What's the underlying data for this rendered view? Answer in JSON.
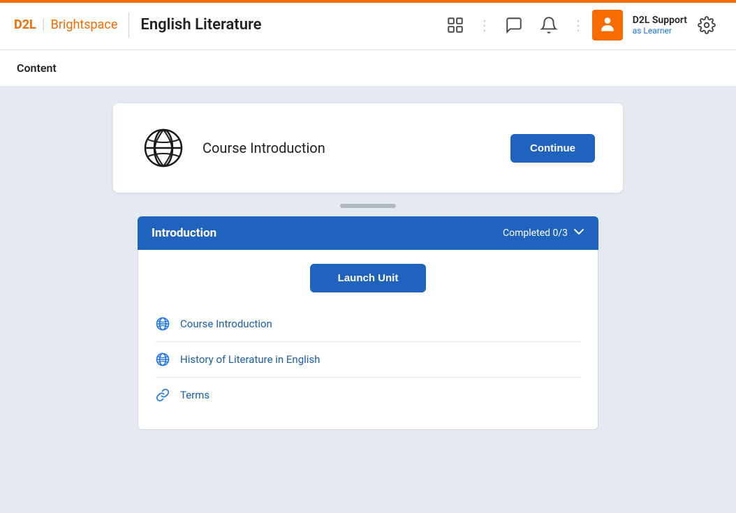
{
  "brand": {
    "d2l": "D2L",
    "separator": "|",
    "brightspace": "Brightspace"
  },
  "header": {
    "course_title": "English Literature"
  },
  "nav": {
    "grid_icon": "grid-icon",
    "chat_icon": "chat-icon",
    "bell_icon": "bell-icon",
    "user_name": "D2L Support",
    "user_role": "as Learner",
    "settings_icon": "settings-icon"
  },
  "content_header": {
    "label": "Content"
  },
  "course_intro": {
    "title": "Course Introduction",
    "continue_label": "Continue"
  },
  "introduction": {
    "title": "Introduction",
    "status": "Completed 0/3",
    "launch_unit_label": "Launch Unit",
    "items": [
      {
        "id": 1,
        "icon": "globe",
        "label": "Course Introduction"
      },
      {
        "id": 2,
        "icon": "globe",
        "label": "History of Literature in English"
      },
      {
        "id": 3,
        "icon": "link",
        "label": "Terms"
      }
    ]
  }
}
